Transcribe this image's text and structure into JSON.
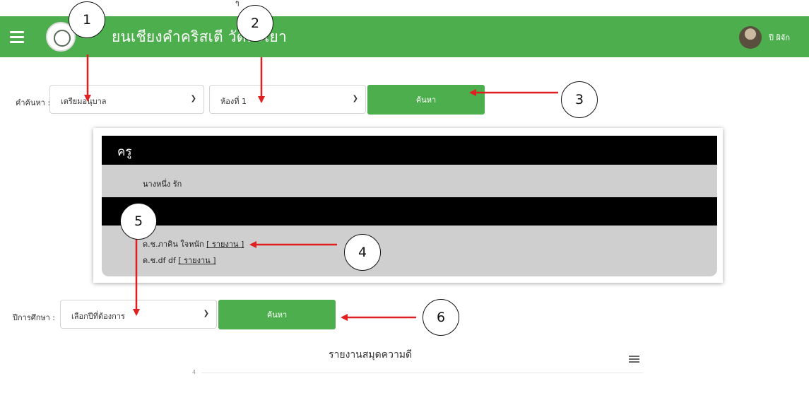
{
  "header": {
    "stray_mark": "ๆ",
    "title": "ยนเชียงคำคริสเตี        วัดพะเยา",
    "user_name": "ปี ผิจัก"
  },
  "search": {
    "label": "คำค้นหา :",
    "level_select": "เตรียมอนุบาล",
    "room_select": "ห้องที่ 1",
    "button_label": "ค้นหา"
  },
  "panel": {
    "teacher_heading": "ครู",
    "teacher_name": "นางหนึ่ง รัก",
    "students": [
      {
        "name": "ด.ช.ภาคิน ใจหนัก",
        "link": "[ รายงาน ]"
      },
      {
        "name": "ด.ช.df df",
        "link": "[ รายงาน ]"
      }
    ]
  },
  "year_filter": {
    "label": "ปีการศึกษา :",
    "select_value": "เลือกปีที่ต้องการ",
    "button_label": "ค้นหา"
  },
  "chart": {
    "title": "รายงานสมุดความดี",
    "tick_label": "4"
  },
  "callouts": [
    "1",
    "2",
    "3",
    "4",
    "5",
    "6"
  ],
  "colors": {
    "header_green": "#4cae4c",
    "button_green": "#4cae4c",
    "band_black": "#000000",
    "panel_gray": "#cfcfcf",
    "arrow_red": "#e02020"
  }
}
